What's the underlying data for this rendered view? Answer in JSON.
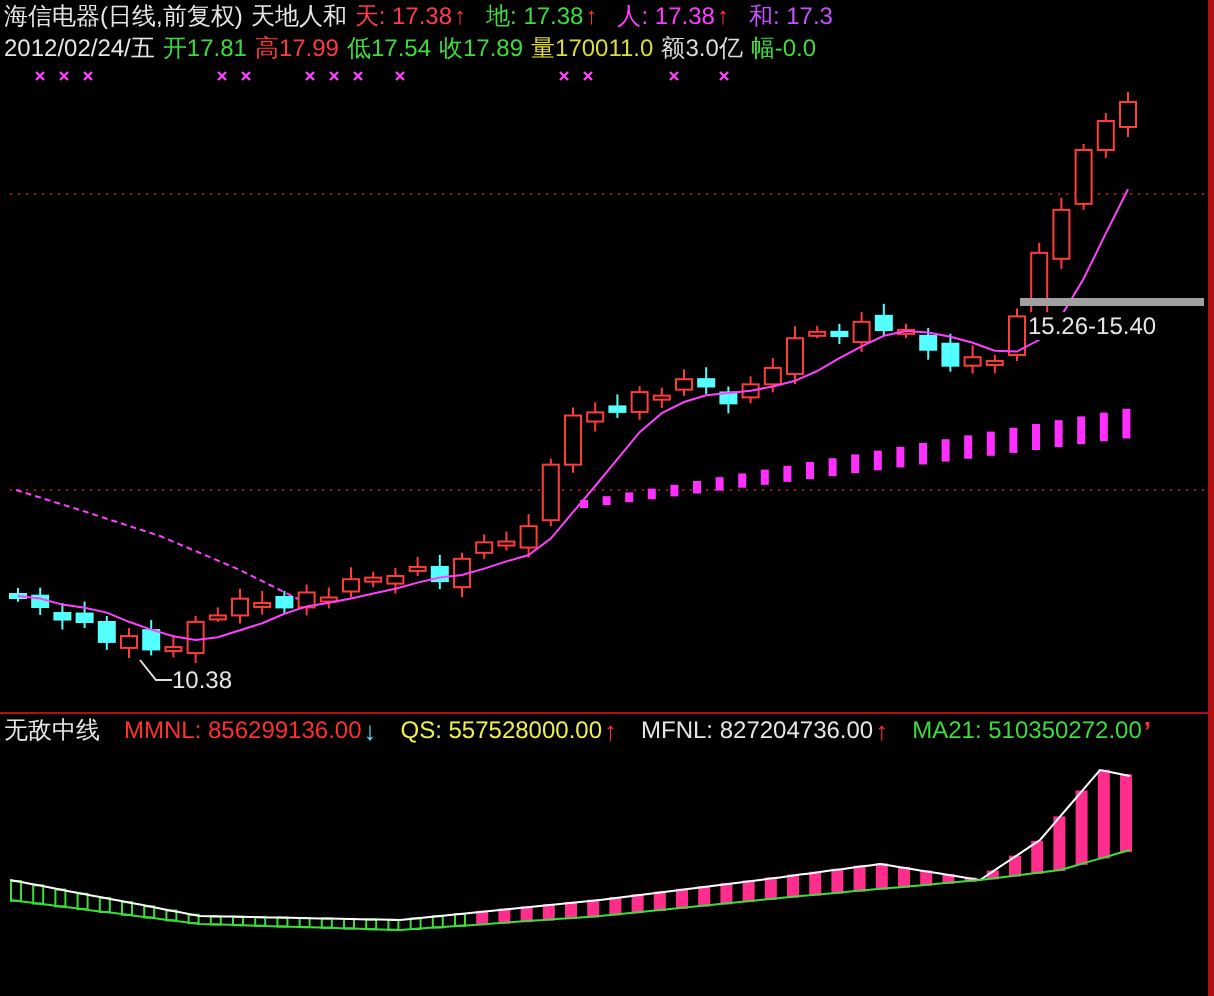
{
  "header": {
    "title": "海信电器(日线,前复权)",
    "indicator": "天地人和",
    "indicator_values": [
      {
        "label": "天: 17.38",
        "arrow": "↑",
        "color": "#ff3c50"
      },
      {
        "label": "地: 17.38",
        "arrow": "↑",
        "color": "#3cdc3c"
      },
      {
        "label": "人: 17.38",
        "arrow": "↑",
        "color": "#ff3cff"
      },
      {
        "label": "和: 17.3",
        "color": "#c850ff"
      }
    ],
    "date": "2012/02/24/五",
    "quote": [
      {
        "label": "开17.81",
        "color": "#3cdc3c"
      },
      {
        "label": "高17.99",
        "color": "#ff3c3c"
      },
      {
        "label": "低17.54",
        "color": "#3cdc3c"
      },
      {
        "label": "收17.89",
        "color": "#3cdc3c"
      },
      {
        "label": "量170011.0",
        "color": "#dcdc3c"
      },
      {
        "label": "额3.0亿",
        "color": "#dcdcdc"
      },
      {
        "label": "幅-0.0",
        "color": "#3cdc3c"
      }
    ]
  },
  "main_chart": {
    "low_label": "10.38",
    "range_label": "15.26-15.40"
  },
  "lower_panel": {
    "name": "无敌中线",
    "values": [
      {
        "label": "MMNL: 856299136.00",
        "arrow": {
          "text": "↓",
          "color": "#50e6ff"
        },
        "color": "#ff3030"
      },
      {
        "label": "QS: 557528000.00",
        "arrow": {
          "text": "↑",
          "color": "#ff3030"
        },
        "color": "#f0f050"
      },
      {
        "label": "MFNL: 827204736.00",
        "arrow": {
          "text": "↑",
          "color": "#ff3030"
        },
        "color": "#e6e6e6"
      },
      {
        "label": "MA21: 510350272.00",
        "arrow": {
          "text": "ʼ",
          "color": "#ff3030"
        },
        "color": "#3cdc3c"
      }
    ]
  }
}
